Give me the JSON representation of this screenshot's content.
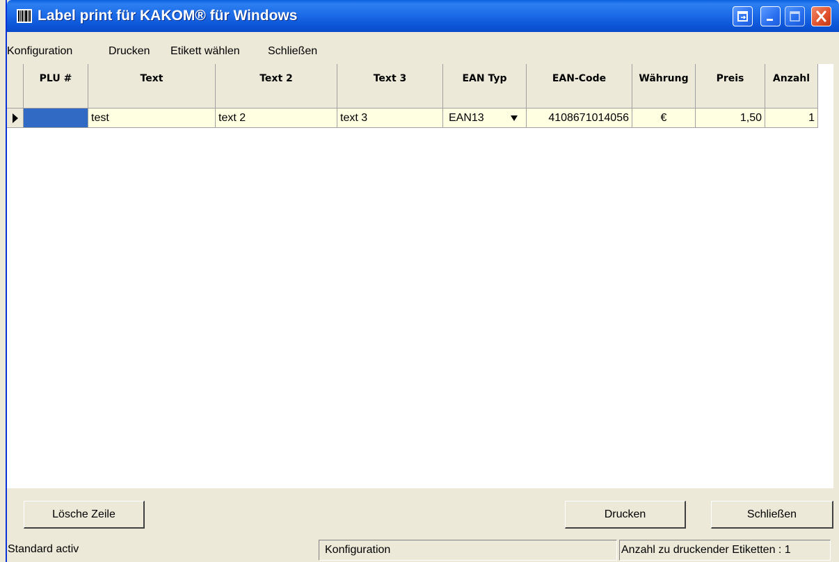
{
  "window": {
    "title": "Label print für KAKOM® für Windows"
  },
  "menu": [
    "Konfiguration",
    "Drucken",
    "Etikett wählen",
    "Schließen"
  ],
  "grid": {
    "columns": [
      "PLU #",
      "Text",
      "Text 2",
      "Text 3",
      "EAN Typ",
      "EAN-Code",
      "Währung",
      "Preis",
      "Anzahl"
    ],
    "rows": [
      {
        "plu": "",
        "text": "test",
        "text2": "text 2",
        "text3": "text 3",
        "ean_typ": "EAN13",
        "ean_code": "4108671014056",
        "waehrung": "€",
        "preis": "1,50",
        "anzahl": "1"
      }
    ]
  },
  "buttons": {
    "delete_row": "Lösche Zeile",
    "print": "Drucken",
    "close": "Schließen"
  },
  "status": {
    "left": "Standard activ",
    "middle": "Konfiguration",
    "right": "Anzahl zu druckender Etiketten : 1"
  }
}
